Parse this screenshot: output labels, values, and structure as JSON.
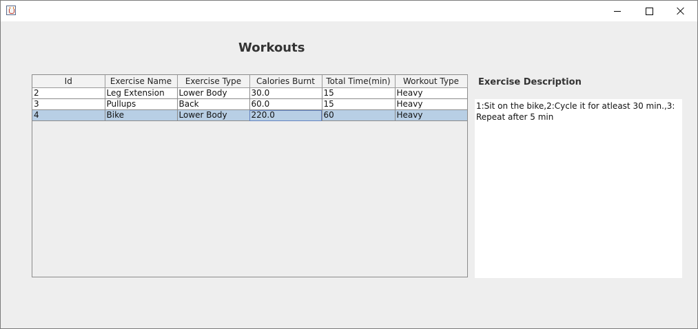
{
  "window": {
    "icon": "java-cup-icon"
  },
  "page": {
    "title": "Workouts"
  },
  "table": {
    "columns": [
      "Id",
      "Exercise Name",
      "Exercise Type",
      "Calories Burnt",
      "Total Time(min)",
      "Workout Type"
    ],
    "rows": [
      [
        "2",
        "Leg Extension",
        "Lower Body",
        "30.0",
        "15",
        "Heavy"
      ],
      [
        "3",
        "Pullups",
        "Back",
        "60.0",
        "15",
        "Heavy"
      ],
      [
        "4",
        "Bike",
        "Lower Body",
        "220.0",
        "60",
        "Heavy"
      ]
    ],
    "selected_row": 2,
    "focused_column": 3
  },
  "description": {
    "title": "Exercise Description",
    "text": "1:Sit on the bike,2:Cycle it for atleast 30 min.,3: Repeat after 5 min"
  },
  "colors": {
    "selection": "#b8cfe5",
    "background": "#eeeeee"
  }
}
